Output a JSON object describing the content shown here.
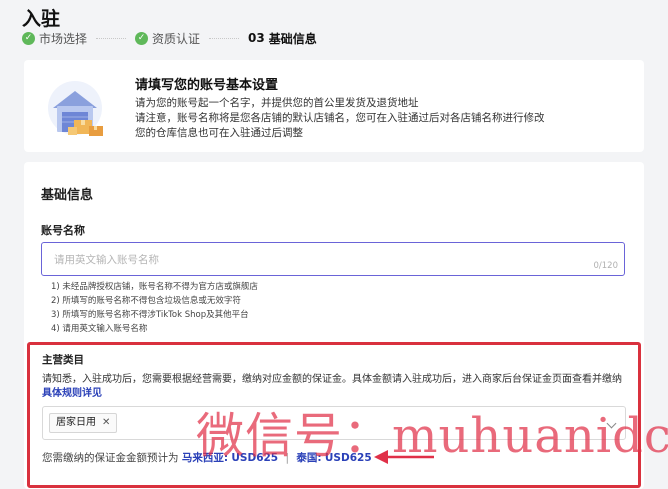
{
  "page": {
    "title": "入驻"
  },
  "steps": [
    {
      "num": "",
      "label": "市场选择",
      "done": true
    },
    {
      "num": "",
      "label": "资质认证",
      "done": true
    },
    {
      "num": "03",
      "label": "基础信息",
      "done": false
    }
  ],
  "intro": {
    "title": "请填写您的账号基本设置",
    "lines": [
      "请为您的账号起一个名字，并提供您的首公里发货及退货地址",
      "请注意，账号名称将是您各店铺的默认店铺名，您可在入驻通过后对各店铺名称进行修改",
      "您的仓库信息也可在入驻通过后调整"
    ]
  },
  "basic_info": {
    "section_title": "基础信息",
    "account_name": {
      "label": "账号名称",
      "placeholder": "请用英文输入账号名称",
      "value": "",
      "counter": "0/120"
    },
    "rules": [
      "1) 未经品牌授权店铺，账号名称不得为官方店或旗舰店",
      "2) 所填写的账号名称不得包含垃圾信息或无效字符",
      "3) 所填写的账号名称不得涉TikTok Shop及其他平台",
      "4) 请用英文输入账号名称"
    ]
  },
  "main_category": {
    "label": "主营类目",
    "description": "请知悉，入驻成功后，您需要根据经营需要，缴纳对应金额的保证金。具体金额请入驻成功后，进入商家后台保证金页面查看并缴纳",
    "rule_link": "具体规则详见",
    "selected_tag": "居家日用",
    "deposit_prefix": "您需缴纳的保证金金额预计为",
    "deposits": [
      {
        "country": "马来西亚",
        "amount": "USD625"
      },
      {
        "country": "泰国",
        "amount": "USD625"
      }
    ],
    "separator": "|"
  },
  "watermark": {
    "text": "微信号：muhuanidc"
  },
  "colors": {
    "accent": "#6a64d8",
    "link": "#2b41b8",
    "success": "#5fb85a",
    "highlight_border": "#d9313e",
    "watermark": "#e03048"
  },
  "icons": {
    "step_done": "check-icon",
    "tag_remove": "close-icon",
    "select_open": "chevron-down-icon",
    "intro_illustration": "store-illustration"
  }
}
